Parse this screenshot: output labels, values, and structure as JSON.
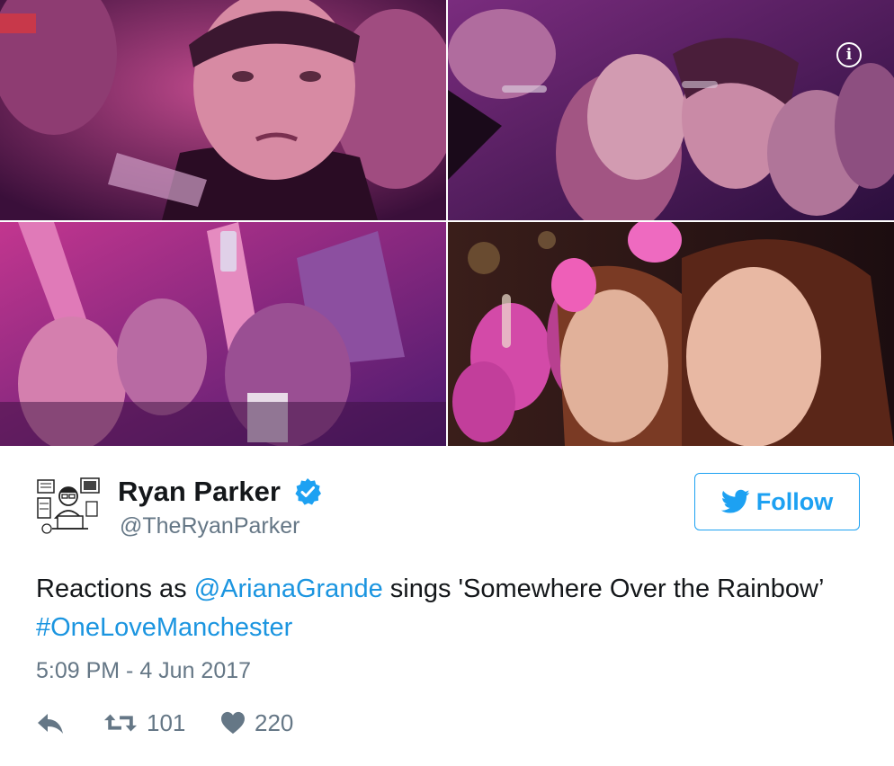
{
  "media": {
    "photos": [
      {
        "name": "crowd-photo-crying-man"
      },
      {
        "name": "crowd-photo-women-watching"
      },
      {
        "name": "crowd-photo-raised-arms"
      },
      {
        "name": "crowd-photo-two-girls-pink-ears"
      }
    ],
    "info_icon": "info-icon"
  },
  "author": {
    "name": "Ryan Parker",
    "handle": "@TheRyanParker",
    "verified_icon": "verified-badge-icon"
  },
  "follow": {
    "label": "Follow",
    "icon": "twitter-bird-icon"
  },
  "tweet": {
    "text_part1": "Reactions as ",
    "mention": "@ArianaGrande",
    "text_part2": " sings 'Somewhere Over the Rainbow’ ",
    "hashtag": "#OneLoveManchester",
    "timestamp": "5:09 PM - 4 Jun 2017"
  },
  "actions": {
    "reply_icon": "reply-icon",
    "retweet_icon": "retweet-icon",
    "retweet_count": "101",
    "like_icon": "heart-icon",
    "like_count": "220"
  },
  "colors": {
    "accent": "#1da1f2",
    "link": "#1b95e0",
    "secondary_text": "#657786",
    "primary_text": "#14171a"
  }
}
